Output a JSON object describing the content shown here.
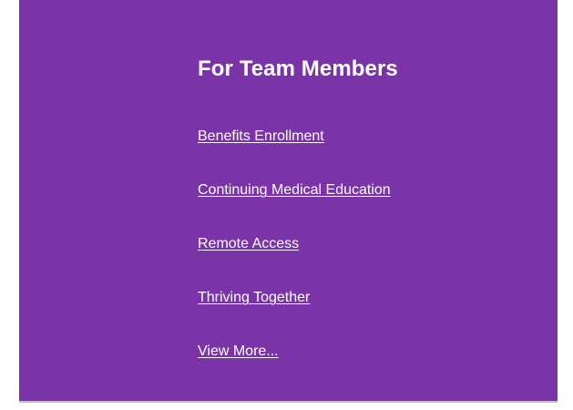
{
  "section": {
    "title": "For Team Members",
    "links": [
      {
        "label": "Benefits Enrollment"
      },
      {
        "label": "Continuing Medical Education"
      },
      {
        "label": "Remote Access"
      },
      {
        "label": "Thriving Together"
      },
      {
        "label": "View More..."
      }
    ]
  },
  "colors": {
    "panel_background": "#7b34a8",
    "text": "#ffffff",
    "page_background": "#ffffff"
  }
}
